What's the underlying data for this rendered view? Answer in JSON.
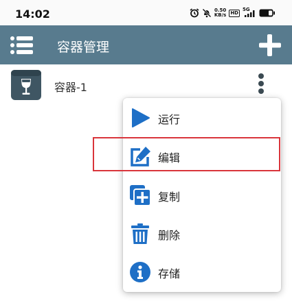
{
  "status_bar": {
    "time": "14:02",
    "net_speed_value": "0.50",
    "net_speed_unit": "KB/s",
    "hd_badge": "HD",
    "network_type": "5G",
    "icons": [
      "alarm-icon",
      "mute-icon",
      "signal-icon",
      "battery-icon"
    ]
  },
  "app_bar": {
    "title": "容器管理",
    "icons": [
      "menu-list-icon",
      "plus-icon"
    ],
    "background_color": "#587b8e"
  },
  "containers": [
    {
      "name": "容器-1",
      "icon": "wine-glass-box-icon"
    }
  ],
  "popup_menu": {
    "items": [
      {
        "label": "运行",
        "icon": "play-icon"
      },
      {
        "label": "编辑",
        "icon": "edit-icon",
        "highlighted": true
      },
      {
        "label": "复制",
        "icon": "copy-add-icon"
      },
      {
        "label": "删除",
        "icon": "trash-icon"
      },
      {
        "label": "存储",
        "icon": "info-icon"
      }
    ],
    "icon_color": "#1e6fc6",
    "highlight_color": "#d9343a"
  }
}
